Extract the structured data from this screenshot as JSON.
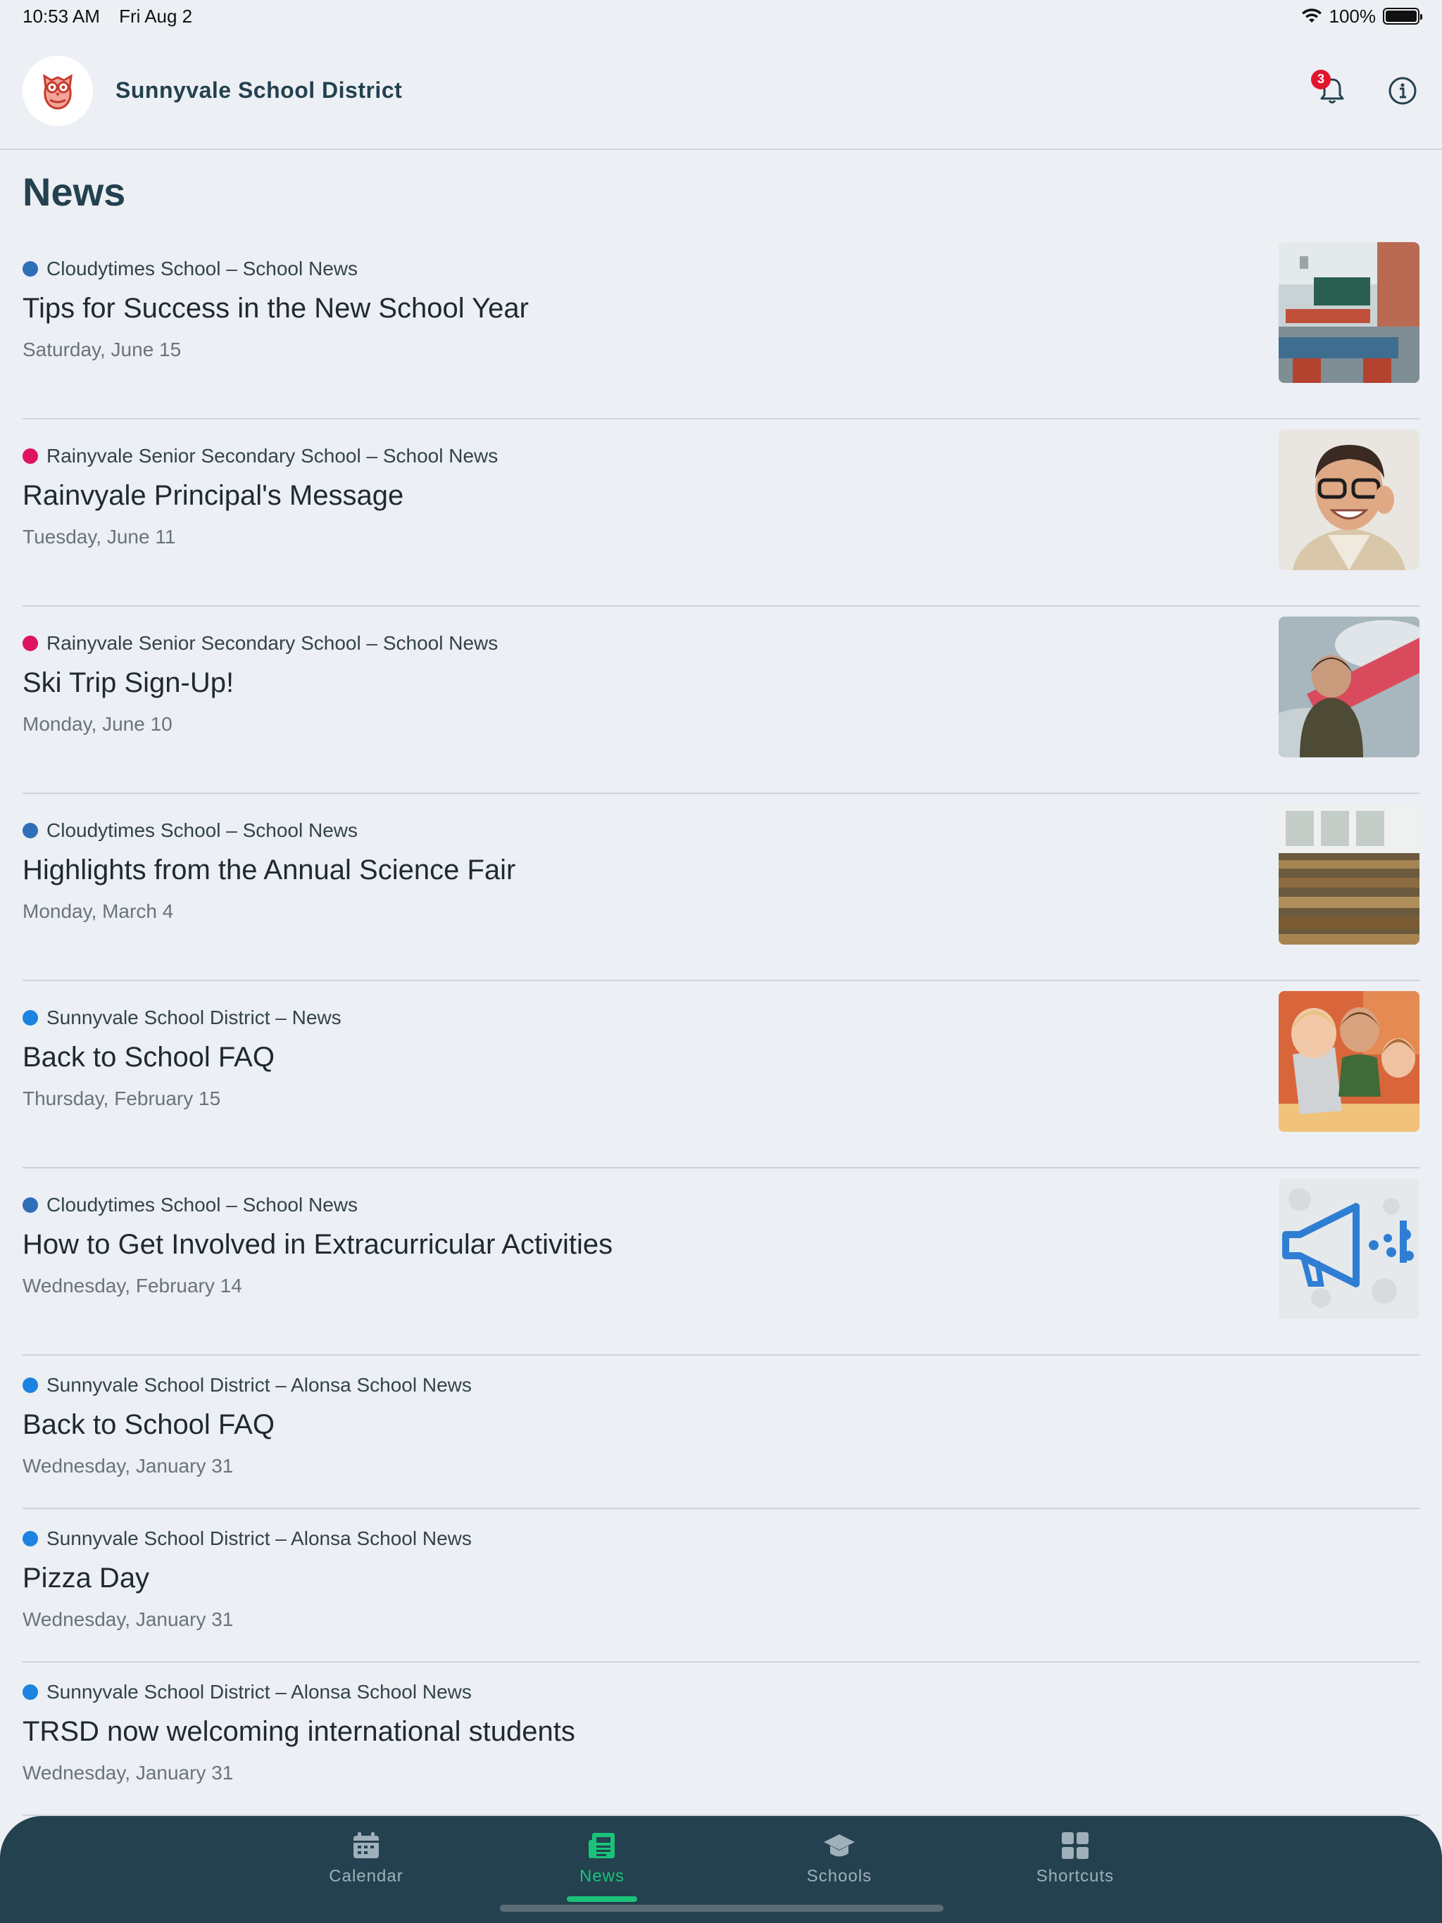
{
  "status": {
    "time": "10:53 AM",
    "date": "Fri Aug 2",
    "battery": "100%"
  },
  "header": {
    "district_name": "Sunnyvale School District",
    "notification_count": "3"
  },
  "page": {
    "title": "News"
  },
  "colors": {
    "cloudytimes": "#2f6fb8",
    "rainyvale": "#df145f",
    "sunnyvale": "#1c83e0",
    "accent_green": "#1bc27a",
    "nav_bg": "#23414f"
  },
  "news": [
    {
      "source": "Cloudytimes School – School News",
      "title": "Tips for Success in the New School Year",
      "date": "Saturday, June 15",
      "dot": "#2f6fb8",
      "image": "classroom"
    },
    {
      "source": "Rainyvale Senior Secondary School – School News",
      "title": "Rainvyale Principal's Message",
      "date": "Tuesday, June 11",
      "dot": "#df145f",
      "image": "portrait"
    },
    {
      "source": "Rainyvale Senior Secondary School – School News",
      "title": "Ski Trip Sign-Up!",
      "date": "Monday, June 10",
      "dot": "#df145f",
      "image": "snowboard"
    },
    {
      "source": "Cloudytimes School – School News",
      "title": "Highlights from the Annual Science Fair",
      "date": "Monday, March 4",
      "dot": "#2f6fb8",
      "image": "library"
    },
    {
      "source": "Sunnyvale School District – News",
      "title": "Back to School FAQ",
      "date": "Thursday, February 15",
      "dot": "#1c83e0",
      "image": "kids-laptop"
    },
    {
      "source": "Cloudytimes School – School News",
      "title": "How to Get Involved in Extracurricular Activities",
      "date": "Wednesday, February 14",
      "dot": "#2f6fb8",
      "image": "megaphone"
    },
    {
      "source": "Sunnyvale School District – Alonsa School News",
      "title": "Back to School FAQ",
      "date": "Wednesday, January 31",
      "dot": "#1c83e0"
    },
    {
      "source": "Sunnyvale School District – Alonsa School News",
      "title": "Pizza Day",
      "date": "Wednesday, January 31",
      "dot": "#1c83e0"
    },
    {
      "source": "Sunnyvale School District – Alonsa School News",
      "title": "TRSD now welcoming international students",
      "date": "Wednesday, January 31",
      "dot": "#1c83e0"
    }
  ],
  "nav": [
    {
      "label": "Calendar",
      "icon": "calendar-icon",
      "active": false
    },
    {
      "label": "News",
      "icon": "news-icon",
      "active": true
    },
    {
      "label": "Schools",
      "icon": "graduation-cap-icon",
      "active": false
    },
    {
      "label": "Shortcuts",
      "icon": "grid-icon",
      "active": false
    }
  ]
}
